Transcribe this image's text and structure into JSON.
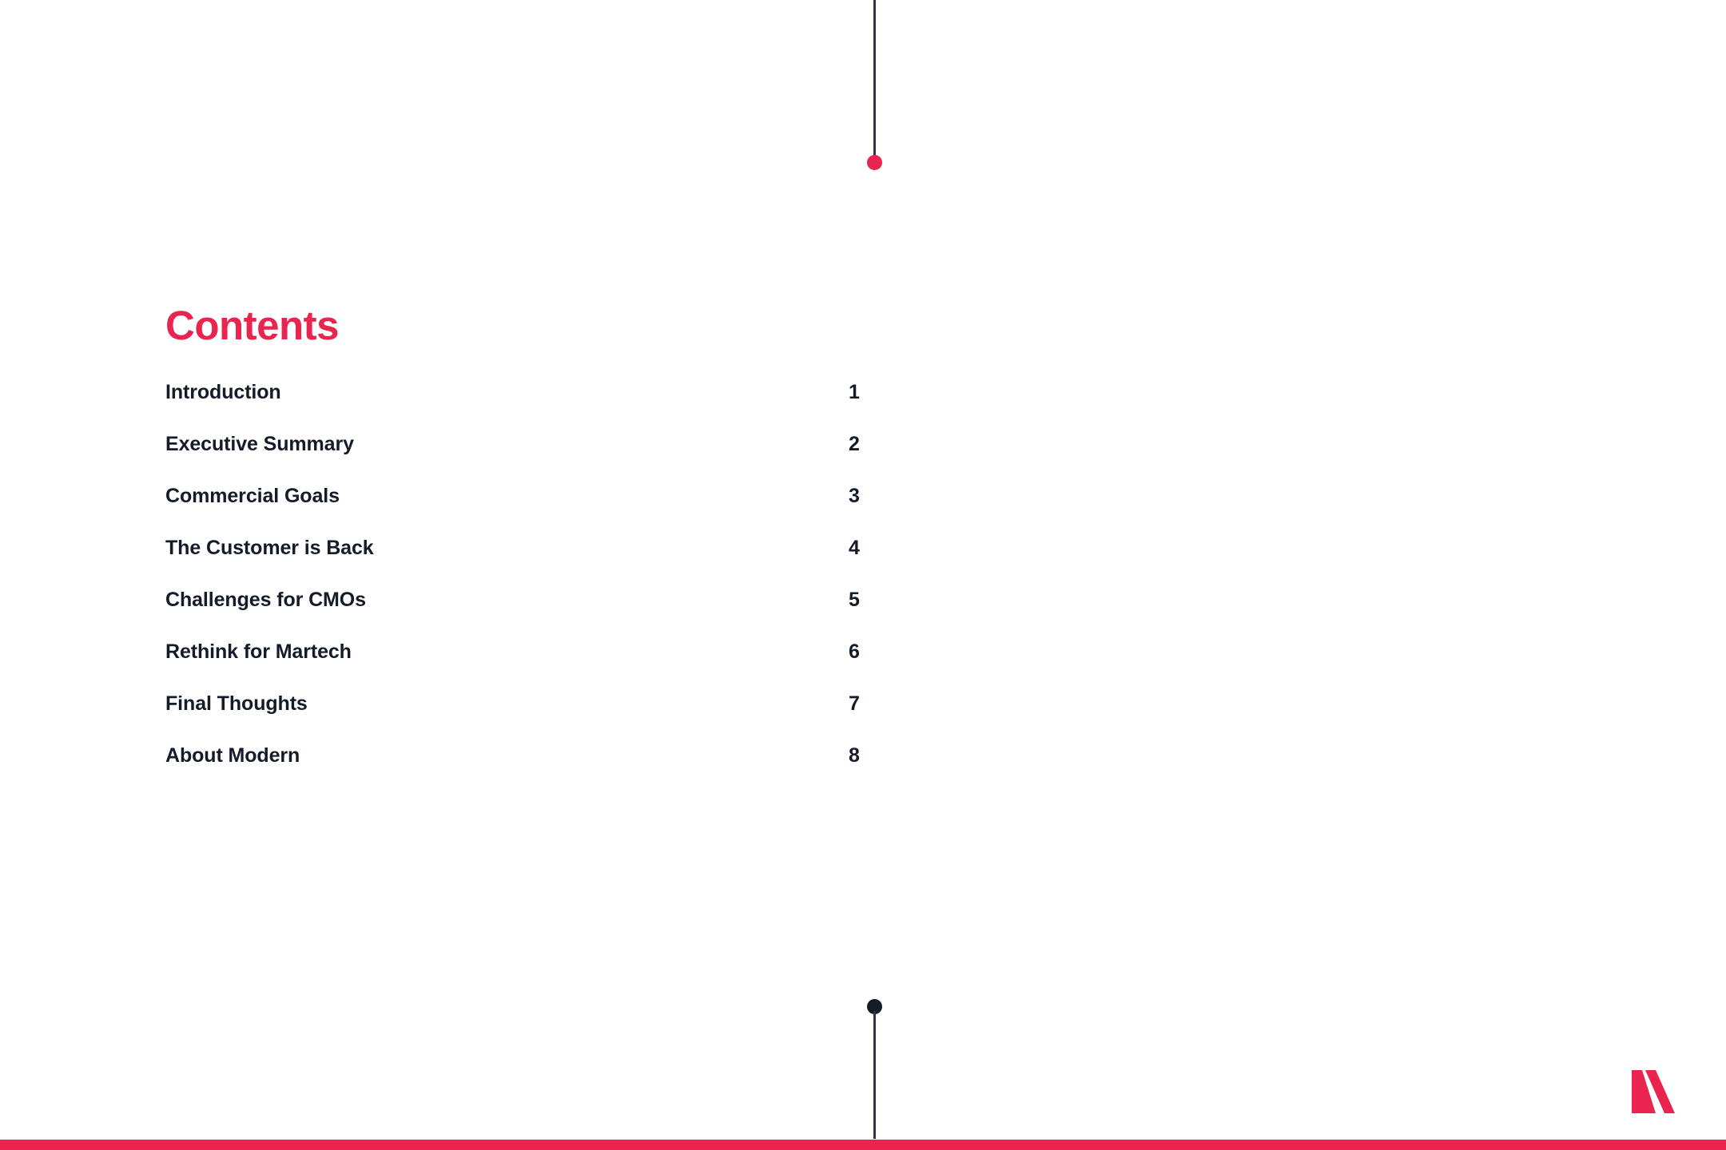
{
  "document": {
    "heading": "Contents",
    "brand_mark": "modern-m-logo"
  },
  "colors": {
    "accent": "#E8244F",
    "text": "#141B29",
    "rule": "#2C3645",
    "background": "#FFFFFF"
  },
  "decoration": {
    "top_rule": "vertical-line",
    "top_dot": "accent-dot",
    "bottom_dot": "dark-dot",
    "bottom_rule": "vertical-line",
    "bottom_bar": "accent-bar"
  },
  "contents": {
    "items": [
      {
        "label": "Introduction",
        "page": "1"
      },
      {
        "label": "Executive Summary",
        "page": "2"
      },
      {
        "label": "Commercial Goals",
        "page": "3"
      },
      {
        "label": "The Customer is Back",
        "page": "4"
      },
      {
        "label": "Challenges for CMOs",
        "page": "5"
      },
      {
        "label": "Rethink for Martech",
        "page": "6"
      },
      {
        "label": "Final Thoughts",
        "page": "7"
      },
      {
        "label": "About Modern",
        "page": "8"
      }
    ]
  }
}
